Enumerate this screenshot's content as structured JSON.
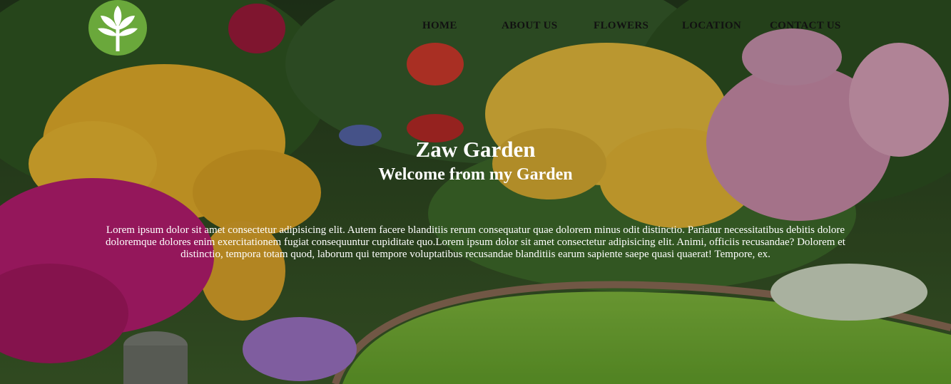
{
  "brand": {
    "logo_icon": "tree-leaf-icon",
    "logo_color": "#6aa83b"
  },
  "nav": {
    "home": "HOME",
    "about": "ABOUT US",
    "flowers": "FLOWERS",
    "location": "LOCATION",
    "contact": "CONTACT US"
  },
  "hero": {
    "title": "Zaw Garden",
    "subtitle": "Welcome from my Garden",
    "paragraph": "Lorem ipsum dolor sit amet consectetur adipisicing elit. Autem facere blanditiis rerum consequatur quae dolorem minus odit distinctio. Pariatur necessitatibus debitis dolore doloremque dolores enim exercitationem fugiat consequuntur cupiditate quo.Lorem ipsum dolor sit amet consectetur adipisicing elit. Animi, officiis recusandae? Dolorem et distinctio, tempora totam quod, laborum qui tempore voluptatibus recusandae blanditiis earum sapiente saepe quasi quaerat! Tempore, ex."
  }
}
